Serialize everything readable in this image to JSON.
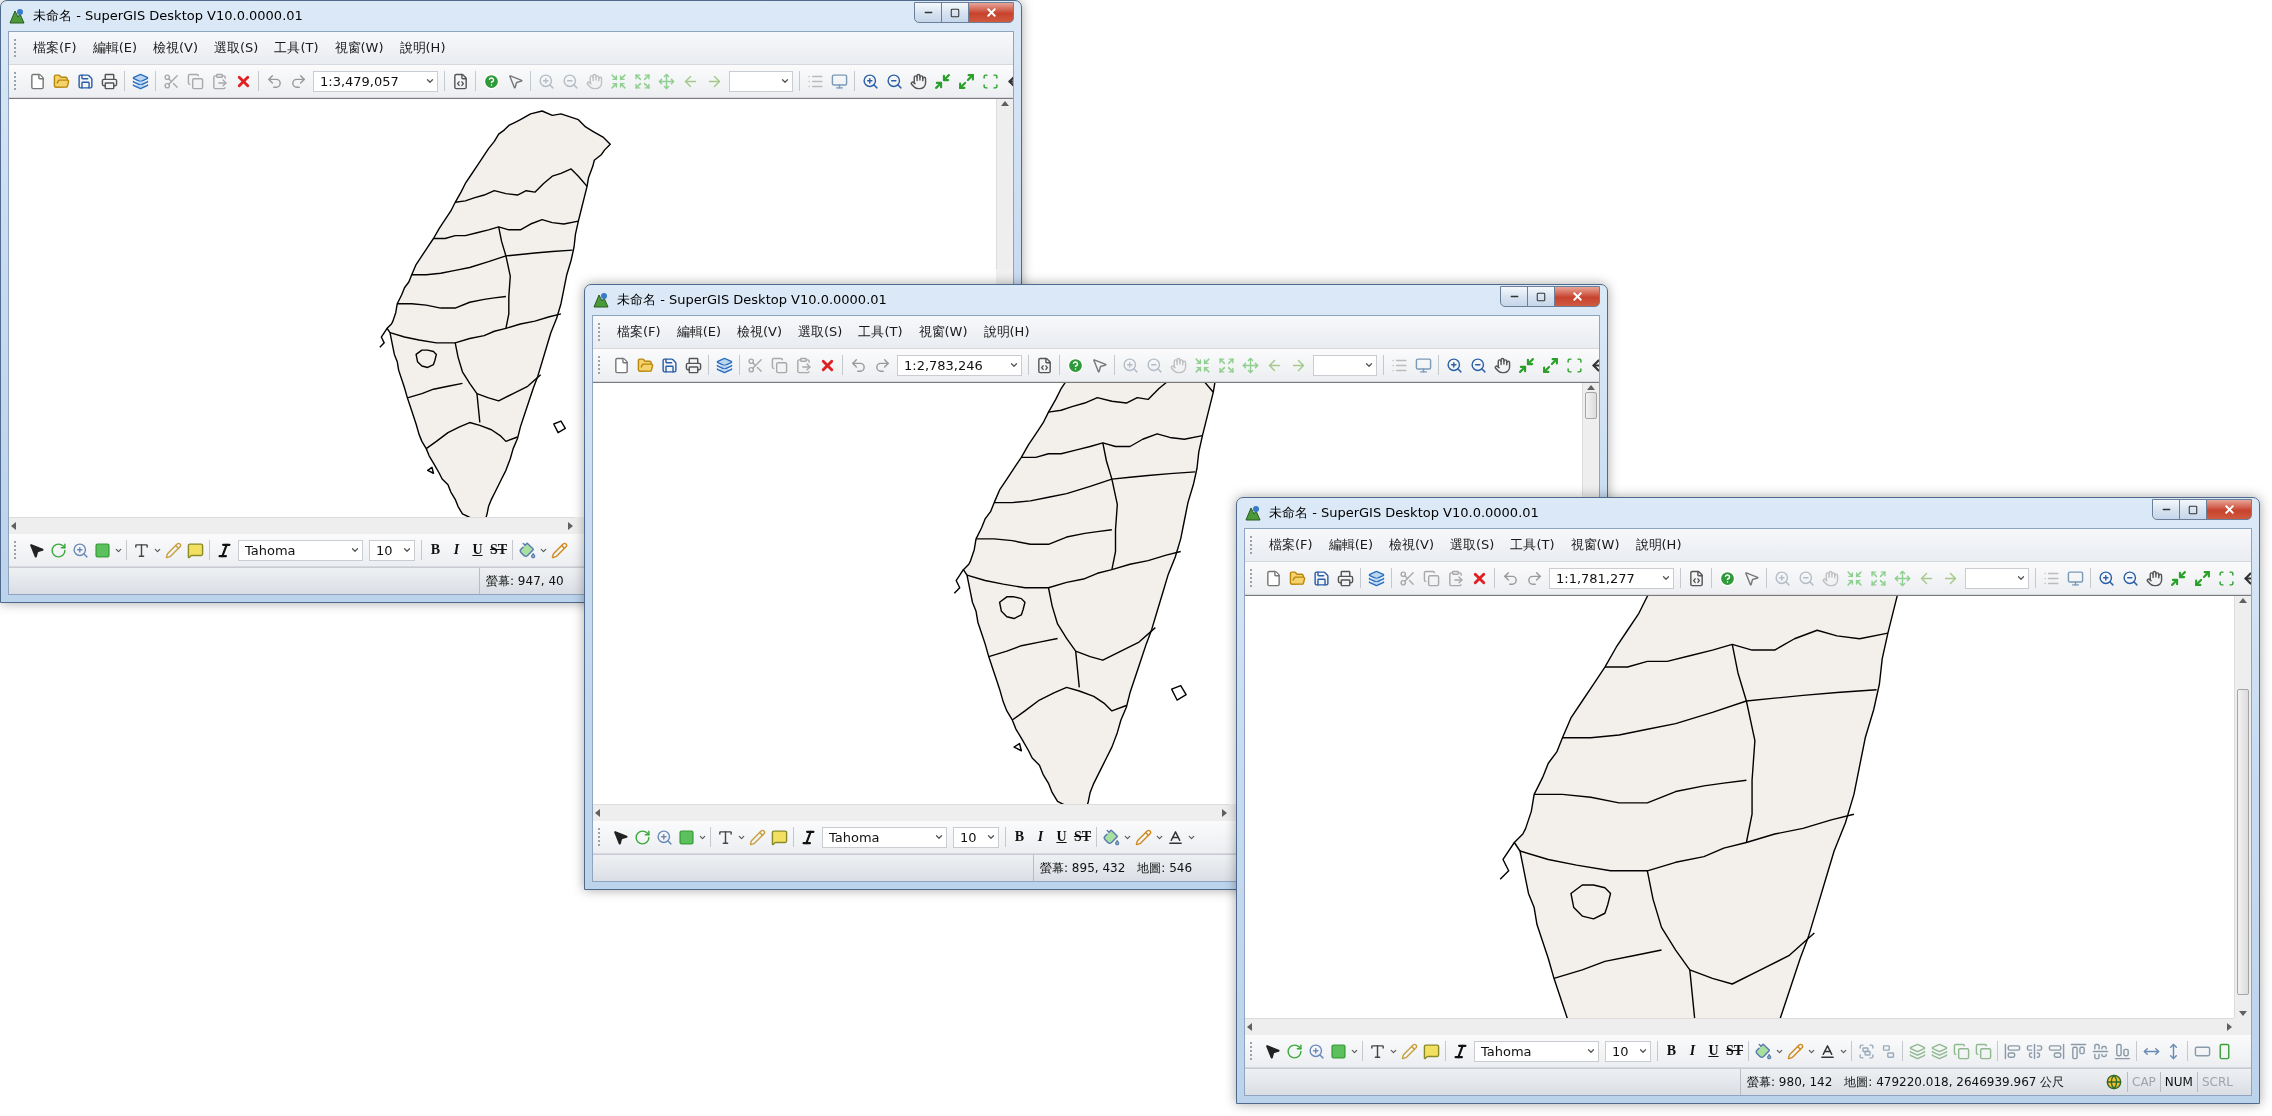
{
  "windows": [
    {
      "title": "未命名 - SuperGIS Desktop V10.0.0000.01",
      "menu": [
        "檔案(F)",
        "編輯(E)",
        "檢視(V)",
        "選取(S)",
        "工具(T)",
        "視窗(W)",
        "說明(H)"
      ],
      "scale": "1:3,479,057",
      "font": "Tahoma",
      "font_size": "10",
      "style_buttons": [
        "B",
        "I",
        "U",
        "ST"
      ],
      "status": {
        "screen": "螢幕: 947, 40"
      }
    },
    {
      "title": "未命名 - SuperGIS Desktop V10.0.0000.01",
      "menu": [
        "檔案(F)",
        "編輯(E)",
        "檢視(V)",
        "選取(S)",
        "工具(T)",
        "視窗(W)",
        "說明(H)"
      ],
      "scale": "1:2,783,246",
      "font": "Tahoma",
      "font_size": "10",
      "style_buttons": [
        "B",
        "I",
        "U",
        "ST"
      ],
      "status": {
        "screen": "螢幕: 895, 432",
        "map": "地圖: 546"
      }
    },
    {
      "title": "未命名 - SuperGIS Desktop V10.0.0000.01",
      "menu": [
        "檔案(F)",
        "編輯(E)",
        "檢視(V)",
        "選取(S)",
        "工具(T)",
        "視窗(W)",
        "說明(H)"
      ],
      "scale": "1:1,781,277",
      "font": "Tahoma",
      "font_size": "10",
      "style_buttons": [
        "B",
        "I",
        "U",
        "ST"
      ],
      "status": {
        "screen": "螢幕: 980, 142",
        "map": "地圖: 479220.018, 2646939.967 公尺",
        "indicators": [
          {
            "label": "CAP",
            "on": false
          },
          {
            "label": "NUM",
            "on": true
          },
          {
            "label": "SCRL",
            "on": false
          }
        ]
      }
    }
  ]
}
